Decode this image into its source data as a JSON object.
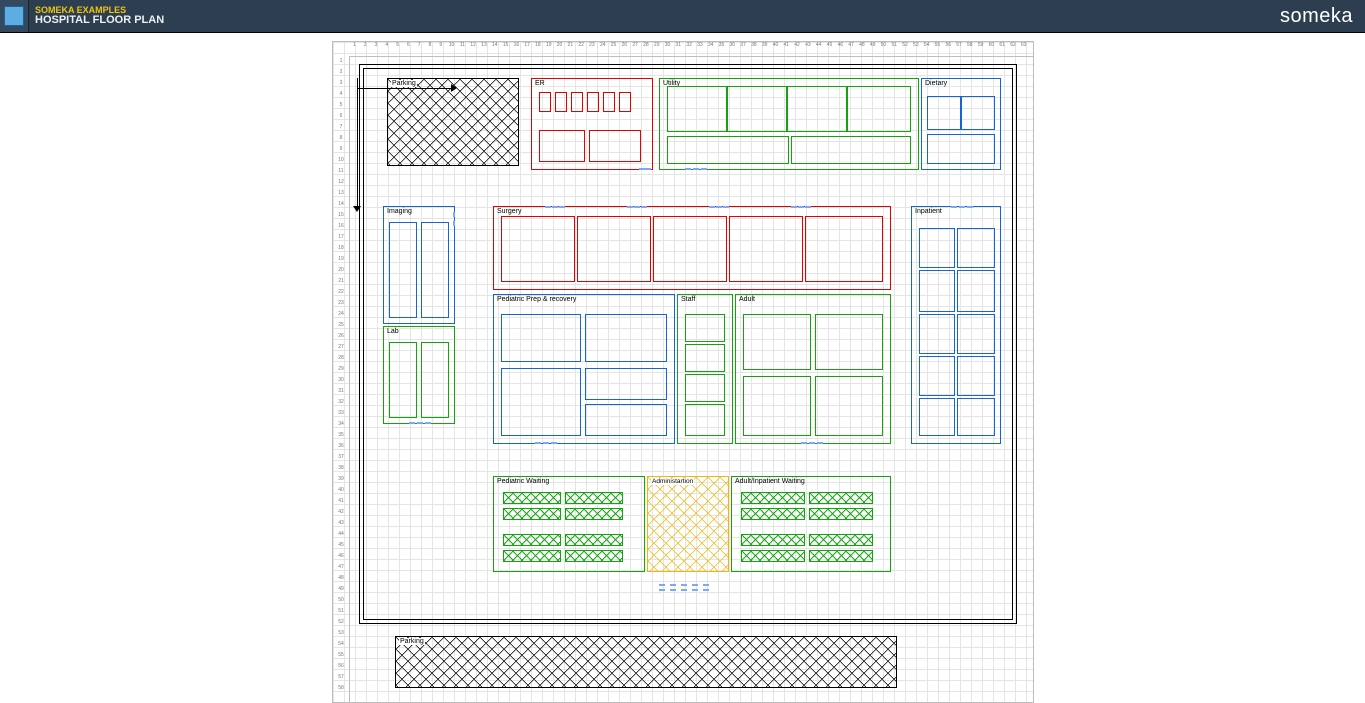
{
  "header": {
    "brand": "SOMEKA EXAMPLES",
    "title": "HOSPITAL FLOOR PLAN",
    "watermark": "someka"
  },
  "labels": {
    "parking": "Parking",
    "er": "ER",
    "utility": "Utility",
    "dietary": "Dietary",
    "imaging": "Imaging",
    "surgery": "Surgery",
    "inpatient": "Inpatient",
    "pedprep": "Pediatric Prep & recovery",
    "staff": "Staff",
    "adult": "Adult",
    "lab": "Lab",
    "pedwaiting": "Pediatric Waiting",
    "admin": "Administartion",
    "adultwaiting": "Adult/Inpatient Waiting"
  },
  "ruler": {
    "cols": 63,
    "rows": 58
  }
}
